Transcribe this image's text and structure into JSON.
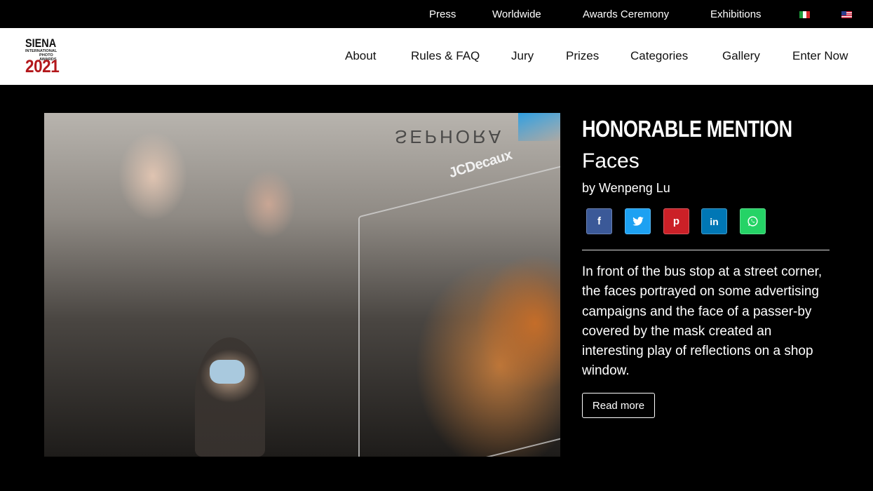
{
  "topnav": {
    "items": [
      "Press",
      "Worldwide",
      "Awards Ceremony",
      "Exhibitions"
    ],
    "flags": [
      "flag-italy-icon",
      "flag-usa-icon"
    ]
  },
  "logo": {
    "line1": "SIENA",
    "line2": "INTERNATIONAL",
    "line3": "PHOTO AWARDS",
    "line4": "2021"
  },
  "mainnav": {
    "items": [
      "About",
      "Rules & FAQ",
      "Jury",
      "Prizes",
      "Categories",
      "Gallery",
      "Enter Now"
    ]
  },
  "photo": {
    "sign_text": "SEPHORA",
    "brand_text": "JCDecaux"
  },
  "award": {
    "label": "HONORABLE MENTION",
    "title": "Faces",
    "author": "by Wenpeng Lu",
    "description": "In front of the bus stop at a street corner, the faces portrayed on some advertising campaigns and the face of a passer-by covered by the mask created an interesting play of reflections on a shop window.",
    "read_more_label": "Read more"
  },
  "share": {
    "icons": [
      "f",
      "t",
      "p",
      "in",
      "w"
    ]
  },
  "colors": {
    "background": "#000000",
    "nav_background": "#ffffff",
    "logo_red": "#b3171b",
    "facebook": "#3b5998",
    "twitter": "#1da1f2",
    "pinterest": "#cb2027",
    "linkedin": "#0077b5",
    "whatsapp": "#25d366"
  }
}
